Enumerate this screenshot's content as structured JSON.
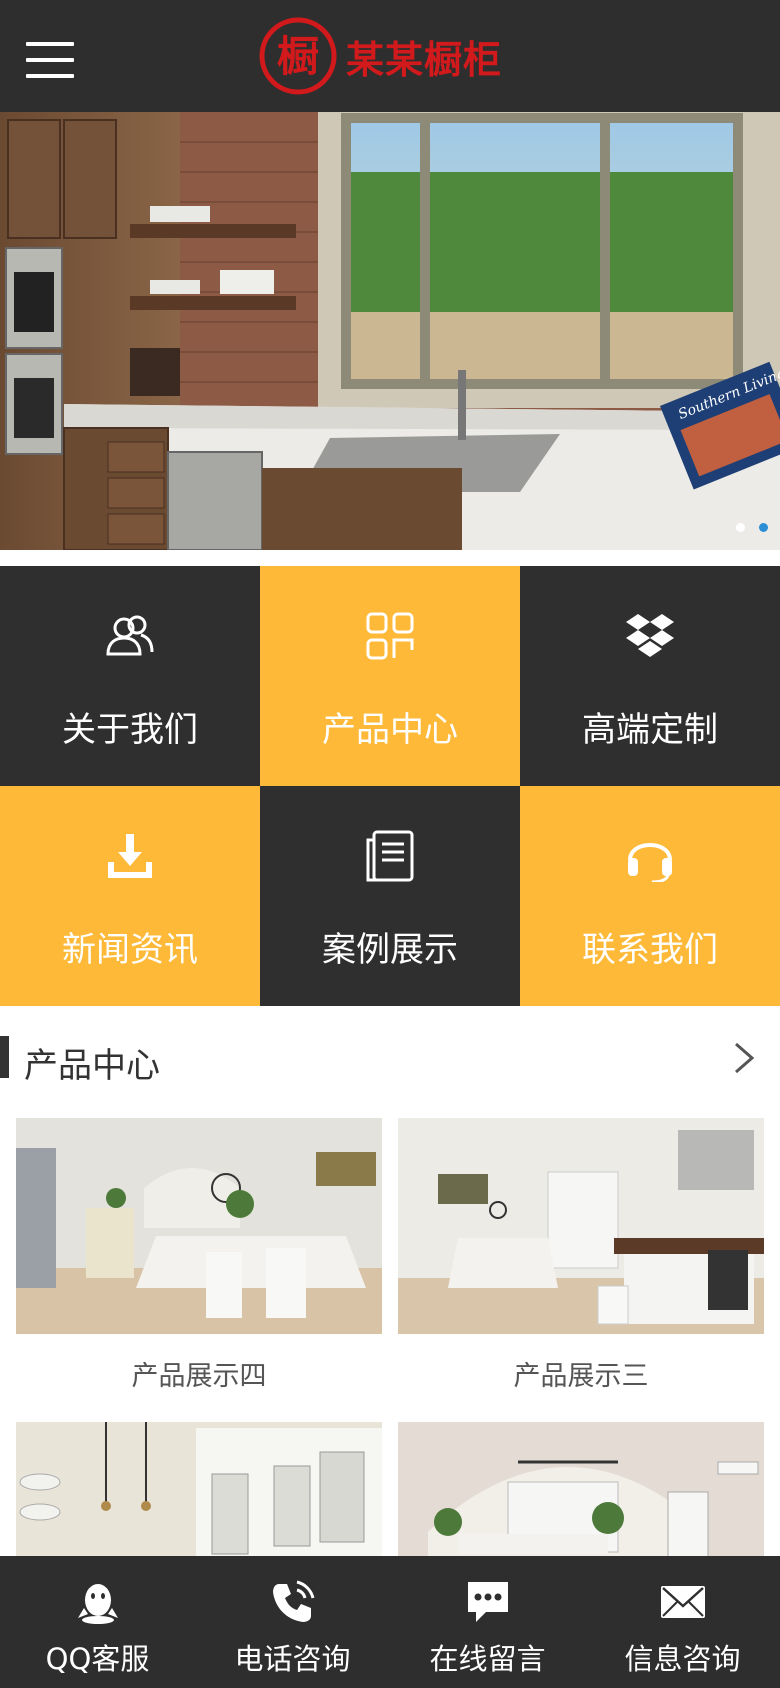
{
  "header": {
    "logo_glyph": "橱",
    "brand_name": "某某橱柜",
    "brand_color": "#d2191c",
    "menu_icon": "hamburger-icon"
  },
  "banner": {
    "slides_count": 2,
    "active_slide": 2,
    "book_title": "Southern Living"
  },
  "nav": {
    "items": [
      {
        "label": "关于我们",
        "icon": "users-icon",
        "color": "#2f2f2f"
      },
      {
        "label": "产品中心",
        "icon": "grid-icon",
        "color": "#fdb937"
      },
      {
        "label": "高端定制",
        "icon": "dropbox-icon",
        "color": "#2f2f2f"
      },
      {
        "label": "新闻资讯",
        "icon": "download-icon",
        "color": "#fdb937"
      },
      {
        "label": "案例展示",
        "icon": "document-icon",
        "color": "#2f2f2f"
      },
      {
        "label": "联系我们",
        "icon": "headset-icon",
        "color": "#fdb937"
      }
    ]
  },
  "products_section": {
    "title": "产品中心",
    "items": [
      {
        "caption": "产品展示四"
      },
      {
        "caption": "产品展示三"
      },
      {
        "caption": ""
      },
      {
        "caption": ""
      }
    ]
  },
  "bottom_bar": {
    "tabs": [
      {
        "label": "QQ客服",
        "icon": "qq-icon"
      },
      {
        "label": "电话咨询",
        "icon": "phone-icon"
      },
      {
        "label": "在线留言",
        "icon": "chat-icon"
      },
      {
        "label": "信息咨询",
        "icon": "mail-icon"
      }
    ]
  }
}
